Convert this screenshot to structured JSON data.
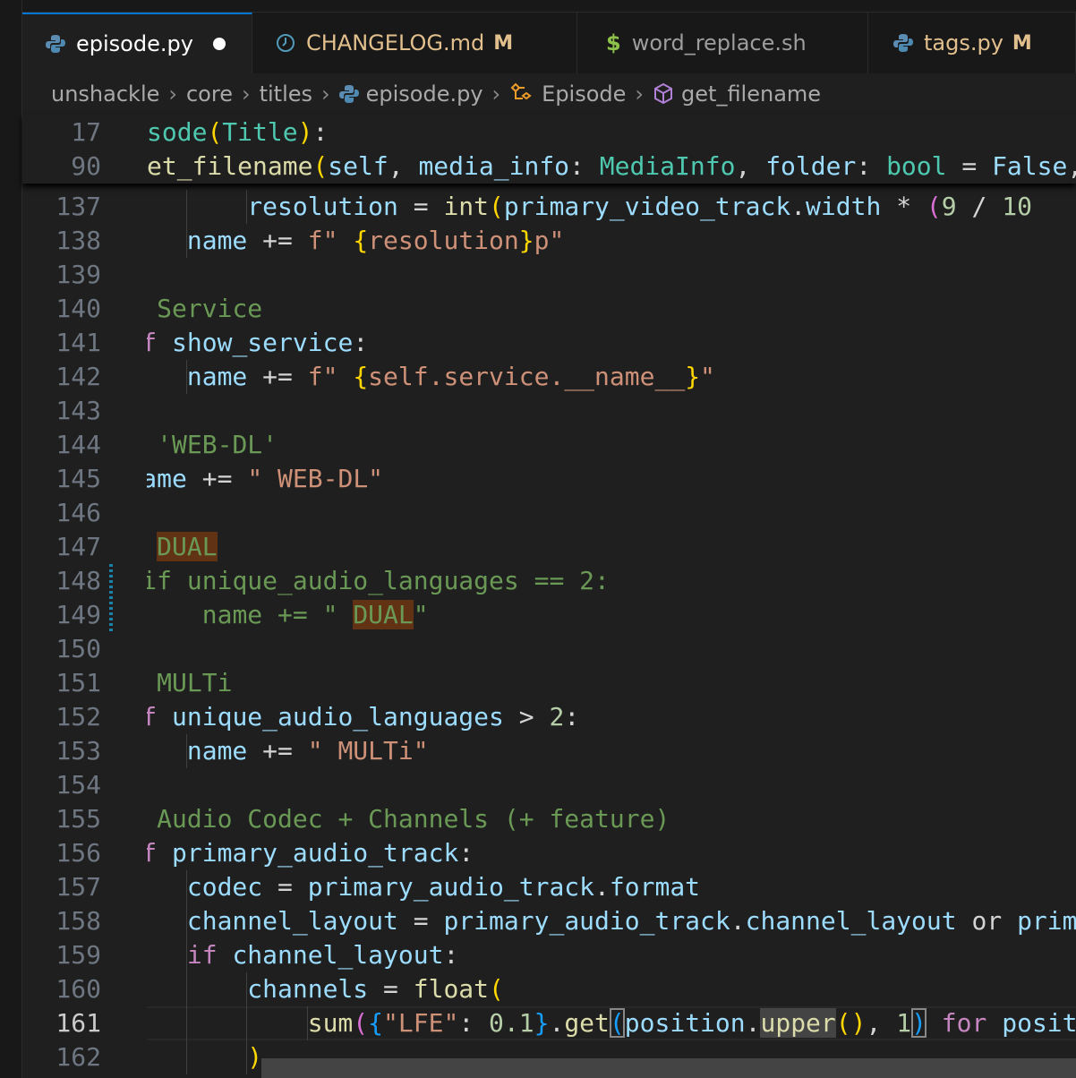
{
  "tabs": [
    {
      "label": "episode.py",
      "icon": "python-icon",
      "dirty": true,
      "active": true
    },
    {
      "label": "CHANGELOG.md",
      "icon": "clock-icon",
      "badge": "M"
    },
    {
      "label": "word_replace.sh",
      "icon": "dollar-icon"
    },
    {
      "label": "tags.py",
      "icon": "python-icon",
      "badge": "M"
    }
  ],
  "breadcrumb": [
    "unshackle",
    "core",
    "titles",
    "episode.py",
    "Episode",
    "get_filename"
  ],
  "sticky": [
    {
      "ln": "17",
      "tokens": [
        [
          "sode",
          "t"
        ],
        [
          "(",
          "y"
        ],
        [
          "Title",
          "t"
        ],
        [
          ")",
          "y"
        ],
        [
          ":",
          "o"
        ]
      ]
    },
    {
      "ln": "90",
      "tokens": [
        [
          "et_filename",
          "f"
        ],
        [
          "(",
          "y"
        ],
        [
          "self",
          "v"
        ],
        [
          ", ",
          "o"
        ],
        [
          "media_info",
          "v"
        ],
        [
          ": ",
          "o"
        ],
        [
          "MediaInfo",
          "t"
        ],
        [
          ", ",
          "o"
        ],
        [
          "folder",
          "v"
        ],
        [
          ": ",
          "o"
        ],
        [
          "bool",
          "t"
        ],
        [
          " = ",
          "o"
        ],
        [
          "False",
          "v"
        ],
        [
          ",",
          "o"
        ]
      ]
    }
  ],
  "lines": [
    {
      "ln": "137",
      "g": 3,
      "tokens": [
        [
          "            ",
          ""
        ],
        [
          "resolution",
          "v"
        ],
        [
          " = ",
          "o"
        ],
        [
          "int",
          "f"
        ],
        [
          "(",
          "y"
        ],
        [
          "primary_video_track",
          "v"
        ],
        [
          ".",
          "o"
        ],
        [
          "width",
          "v"
        ],
        [
          " * ",
          "o"
        ],
        [
          "(",
          "p"
        ],
        [
          "9",
          "n"
        ],
        [
          " / ",
          "o"
        ],
        [
          "10",
          "n"
        ]
      ]
    },
    {
      "ln": "138",
      "g": 2,
      "tokens": [
        [
          "        ",
          ""
        ],
        [
          "name",
          "v"
        ],
        [
          " += ",
          "o"
        ],
        [
          "f\" ",
          "s"
        ],
        [
          "{",
          "y"
        ],
        [
          "resolution",
          "s"
        ],
        [
          "}",
          "y"
        ],
        [
          "p\"",
          "s"
        ]
      ]
    },
    {
      "ln": "139",
      "g": 1,
      "tokens": []
    },
    {
      "ln": "140",
      "g": 1,
      "tokens": [
        [
          "    ",
          ""
        ],
        [
          "# Service",
          "c"
        ]
      ]
    },
    {
      "ln": "141",
      "g": 1,
      "tokens": [
        [
          "    ",
          ""
        ],
        [
          "if",
          "k"
        ],
        [
          " ",
          "o"
        ],
        [
          "show_service",
          "v"
        ],
        [
          ":",
          "o"
        ]
      ]
    },
    {
      "ln": "142",
      "g": 2,
      "tokens": [
        [
          "        ",
          ""
        ],
        [
          "name",
          "v"
        ],
        [
          " += ",
          "o"
        ],
        [
          "f\" ",
          "s"
        ],
        [
          "{",
          "y"
        ],
        [
          "self.service.__name__",
          "s"
        ],
        [
          "}",
          "y"
        ],
        [
          "\"",
          "s"
        ]
      ]
    },
    {
      "ln": "143",
      "g": 1,
      "tokens": []
    },
    {
      "ln": "144",
      "g": 1,
      "tokens": [
        [
          "    ",
          ""
        ],
        [
          "# 'WEB-DL'",
          "c"
        ]
      ]
    },
    {
      "ln": "145",
      "g": 1,
      "tokens": [
        [
          "    ",
          ""
        ],
        [
          "name",
          "v"
        ],
        [
          " += ",
          "o"
        ],
        [
          "\" WEB-DL\"",
          "s"
        ]
      ]
    },
    {
      "ln": "146",
      "g": 1,
      "tokens": []
    },
    {
      "ln": "147",
      "g": 1,
      "tokens": [
        [
          "    ",
          ""
        ],
        [
          "# ",
          "c"
        ],
        [
          "DUAL",
          "c find"
        ]
      ]
    },
    {
      "ln": "148",
      "g": 1,
      "tokens": [
        [
          "    ",
          ""
        ],
        [
          "#if unique_audio_languages == 2:",
          "c"
        ]
      ]
    },
    {
      "ln": "149",
      "g": 1,
      "tokens": [
        [
          "    ",
          ""
        ],
        [
          "#    name += \" ",
          "c"
        ],
        [
          "DUAL",
          "c find"
        ],
        [
          "\"",
          "c"
        ]
      ]
    },
    {
      "ln": "150",
      "g": 1,
      "tokens": []
    },
    {
      "ln": "151",
      "g": 1,
      "tokens": [
        [
          "    ",
          ""
        ],
        [
          "# MULTi",
          "c"
        ]
      ]
    },
    {
      "ln": "152",
      "g": 1,
      "tokens": [
        [
          "    ",
          ""
        ],
        [
          "if",
          "k"
        ],
        [
          " ",
          "o"
        ],
        [
          "unique_audio_languages",
          "v"
        ],
        [
          " > ",
          "o"
        ],
        [
          "2",
          "n"
        ],
        [
          ":",
          "o"
        ]
      ]
    },
    {
      "ln": "153",
      "g": 2,
      "tokens": [
        [
          "        ",
          ""
        ],
        [
          "name",
          "v"
        ],
        [
          " += ",
          "o"
        ],
        [
          "\" MULTi\"",
          "s"
        ]
      ]
    },
    {
      "ln": "154",
      "g": 1,
      "tokens": []
    },
    {
      "ln": "155",
      "g": 1,
      "tokens": [
        [
          "    ",
          ""
        ],
        [
          "# Audio Codec + Channels (+ feature)",
          "c"
        ]
      ]
    },
    {
      "ln": "156",
      "g": 1,
      "tokens": [
        [
          "    ",
          ""
        ],
        [
          "if",
          "k"
        ],
        [
          " ",
          "o"
        ],
        [
          "primary_audio_track",
          "v"
        ],
        [
          ":",
          "o"
        ]
      ]
    },
    {
      "ln": "157",
      "g": 2,
      "tokens": [
        [
          "        ",
          ""
        ],
        [
          "codec",
          "v"
        ],
        [
          " = ",
          "o"
        ],
        [
          "primary_audio_track",
          "v"
        ],
        [
          ".",
          "o"
        ],
        [
          "format",
          "v"
        ]
      ]
    },
    {
      "ln": "158",
      "g": 2,
      "tokens": [
        [
          "        ",
          ""
        ],
        [
          "channel_layout",
          "v"
        ],
        [
          " = ",
          "o"
        ],
        [
          "primary_audio_track",
          "v"
        ],
        [
          ".",
          "o"
        ],
        [
          "channel_layout",
          "v"
        ],
        [
          " or ",
          "o"
        ],
        [
          "primary",
          "v"
        ]
      ]
    },
    {
      "ln": "159",
      "g": 2,
      "tokens": [
        [
          "        ",
          ""
        ],
        [
          "if",
          "k"
        ],
        [
          " ",
          "o"
        ],
        [
          "channel_layout",
          "v"
        ],
        [
          ":",
          "o"
        ]
      ]
    },
    {
      "ln": "160",
      "g": 3,
      "tokens": [
        [
          "            ",
          ""
        ],
        [
          "channels",
          "v"
        ],
        [
          " = ",
          "o"
        ],
        [
          "float",
          "f"
        ],
        [
          "(",
          "y"
        ]
      ]
    },
    {
      "ln": "161",
      "g": 4,
      "cur": true,
      "tokens": [
        [
          "                ",
          ""
        ],
        [
          "sum",
          "f"
        ],
        [
          "(",
          "p"
        ],
        [
          "{",
          "b"
        ],
        [
          "\"LFE\"",
          "s"
        ],
        [
          ": ",
          "o"
        ],
        [
          "0.1",
          "n"
        ],
        [
          "}",
          "b"
        ],
        [
          ".",
          "o"
        ],
        [
          "get",
          "f"
        ],
        [
          "(",
          "b bm"
        ],
        [
          "position",
          "v"
        ],
        [
          ".",
          "o"
        ],
        [
          "upper",
          "f wh"
        ],
        [
          "(",
          "y"
        ],
        [
          ")",
          "y"
        ],
        [
          ", ",
          "o"
        ],
        [
          "1",
          "n"
        ],
        [
          ")",
          "b bm"
        ],
        [
          " ",
          "o"
        ],
        [
          "for",
          "k"
        ],
        [
          " ",
          "o"
        ],
        [
          "position",
          "v"
        ]
      ]
    },
    {
      "ln": "162",
      "g": 3,
      "tokens": [
        [
          "            ",
          ""
        ],
        [
          ")",
          "y"
        ]
      ]
    }
  ],
  "colors": {
    "accent": "#0078d4",
    "background": "#1f1f1f"
  }
}
